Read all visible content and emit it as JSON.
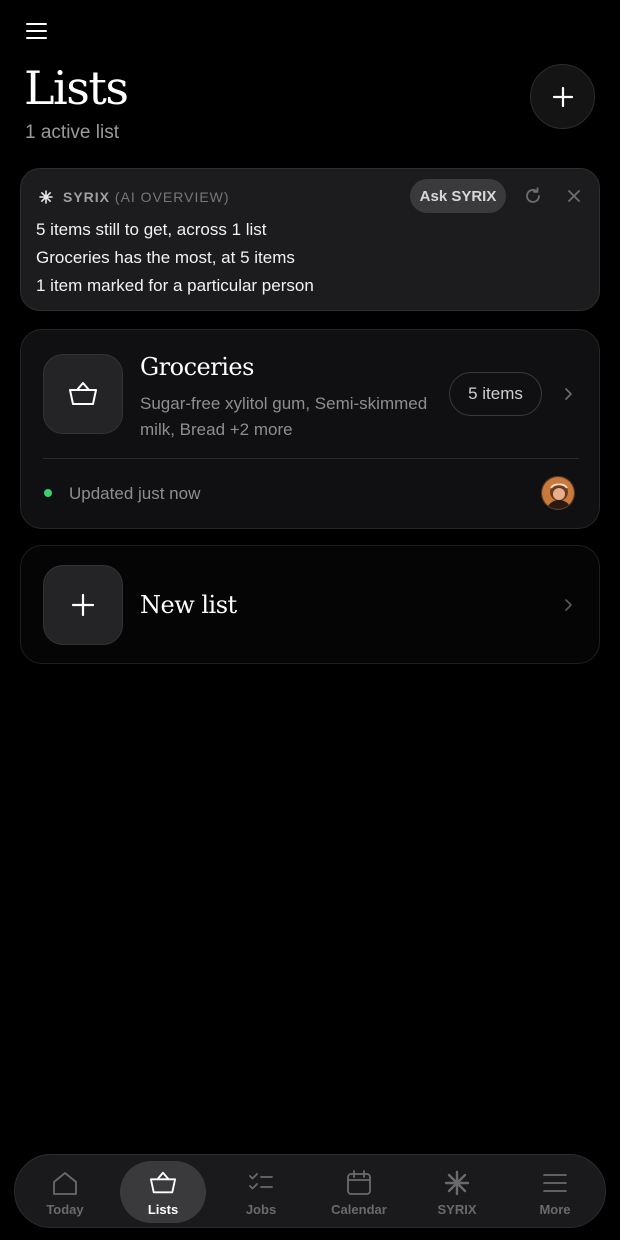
{
  "header": {
    "title": "Lists",
    "subtitle": "1 active list"
  },
  "ai_overview": {
    "brand": "SYRIX",
    "brand_suffix": "(AI OVERVIEW)",
    "ask_label": "Ask SYRIX",
    "lines": [
      "5 items still to get, across 1 list",
      "Groceries has the most, at 5 items",
      "1 item marked for a particular person"
    ]
  },
  "lists": [
    {
      "name": "Groceries",
      "icon": "basket-icon",
      "preview": "Sugar-free xylitol gum, Semi-skimmed milk, Bread +2 more",
      "count_label": "5 items",
      "status": "Updated just now",
      "status_color": "#3ccf6e"
    }
  ],
  "new_list": {
    "label": "New list"
  },
  "tabbar": {
    "active": "Lists",
    "tabs": [
      {
        "label": "Today",
        "icon": "home-icon"
      },
      {
        "label": "Lists",
        "icon": "basket-icon"
      },
      {
        "label": "Jobs",
        "icon": "checklist-icon"
      },
      {
        "label": "Calendar",
        "icon": "calendar-icon"
      },
      {
        "label": "SYRIX",
        "icon": "syrix-icon"
      },
      {
        "label": "More",
        "icon": "more-icon"
      }
    ]
  },
  "colors": {
    "background": "#000000",
    "card": "#1c1c1e",
    "accent_green": "#3ccf6e"
  }
}
